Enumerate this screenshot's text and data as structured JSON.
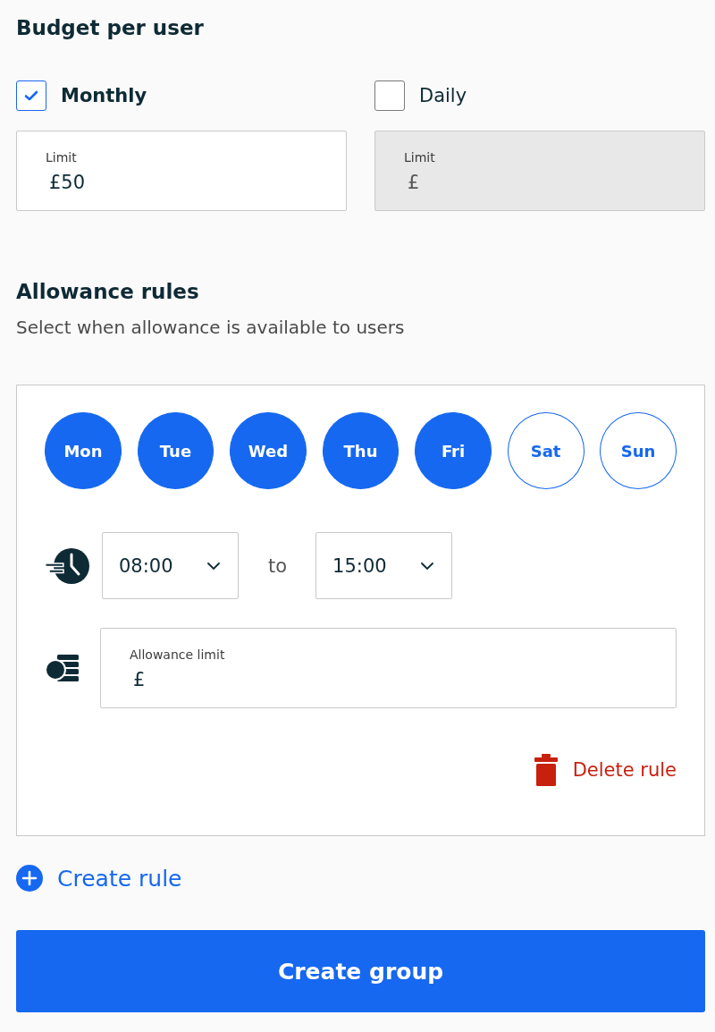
{
  "budget": {
    "title": "Budget per user",
    "options": [
      {
        "label": "Monthly",
        "checked": true,
        "field": {
          "label": "Limit",
          "value": "£50",
          "disabled": false
        }
      },
      {
        "label": "Daily",
        "checked": false,
        "field": {
          "label": "Limit",
          "value": "£",
          "disabled": true
        }
      }
    ]
  },
  "allowance": {
    "title": "Allowance rules",
    "subtitle": "Select when allowance is available to users",
    "rules": [
      {
        "days": [
          {
            "label": "Mon",
            "selected": true
          },
          {
            "label": "Tue",
            "selected": true
          },
          {
            "label": "Wed",
            "selected": true
          },
          {
            "label": "Thu",
            "selected": true
          },
          {
            "label": "Fri",
            "selected": true
          },
          {
            "label": "Sat",
            "selected": false
          },
          {
            "label": "Sun",
            "selected": false
          }
        ],
        "from": "08:00",
        "connector": "to",
        "to": "15:00",
        "limit": {
          "label": "Allowance limit",
          "value": "£"
        },
        "delete": "Delete rule"
      }
    ],
    "create_rule": "Create rule"
  },
  "submit": "Create group"
}
